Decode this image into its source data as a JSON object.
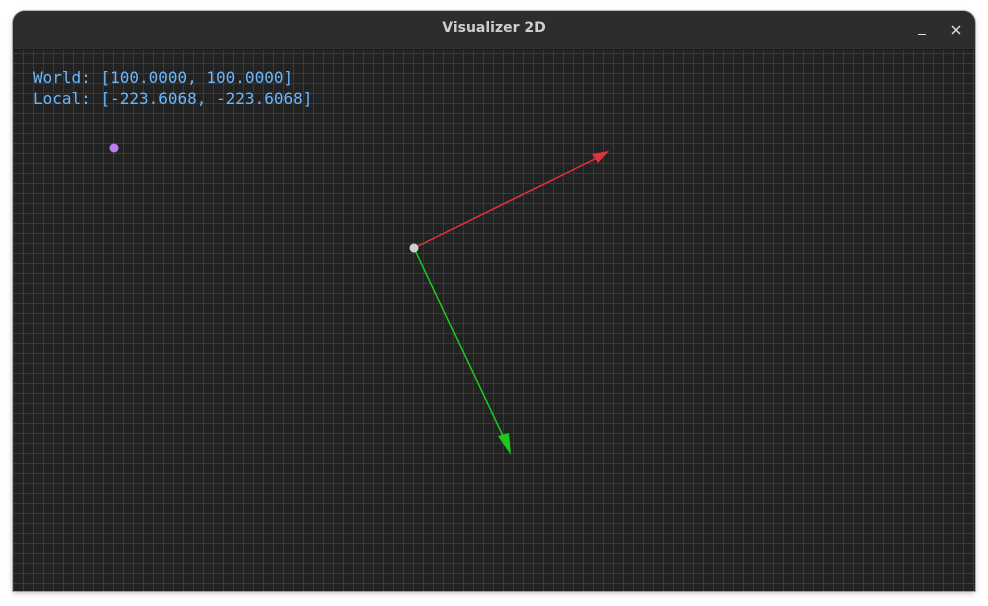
{
  "window": {
    "title": "Visualizer 2D"
  },
  "controls": {
    "minimize_icon": "minimize-icon",
    "close_icon": "close-icon"
  },
  "readout": {
    "world_label": "World:",
    "world_value": "[100.0000, 100.0000]",
    "local_label": "Local:",
    "local_value": "[-223.6068, -223.6068]"
  },
  "colors": {
    "background": "#222222",
    "grid": "#3a3a3a",
    "readout_text": "#6ab7ff",
    "x_axis": "#e0323c",
    "y_axis": "#1ec81e",
    "origin_point": "#d0d0d0",
    "world_point": "#c07af0"
  }
}
